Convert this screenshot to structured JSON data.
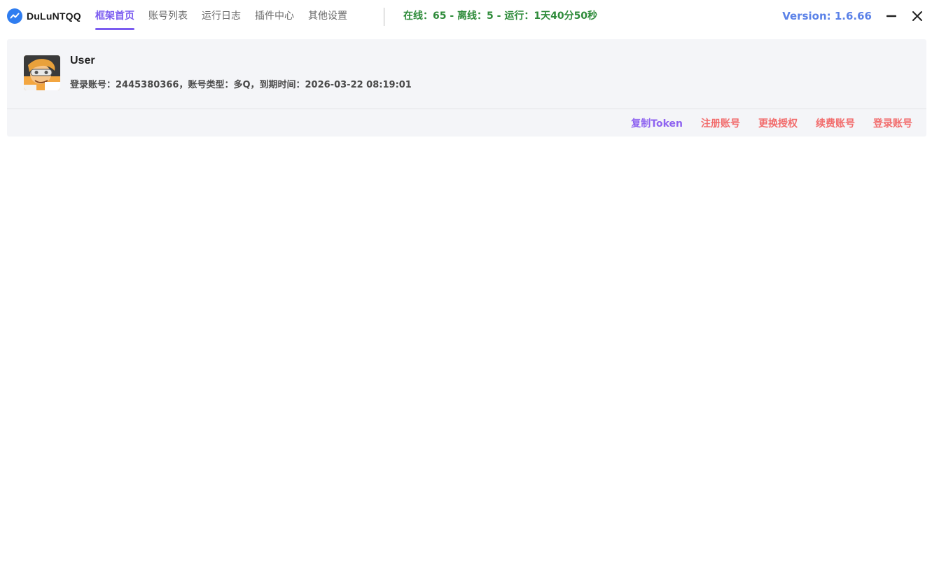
{
  "app": {
    "name": "DuLuNTQQ",
    "version": "Version: 1.6.66",
    "status": "在线：65 - 离线：5 - 运行：1天40分50秒"
  },
  "tabs": [
    {
      "label": "框架首页",
      "active": true
    },
    {
      "label": "账号列表",
      "active": false
    },
    {
      "label": "运行日志",
      "active": false
    },
    {
      "label": "插件中心",
      "active": false
    },
    {
      "label": "其他设置",
      "active": false
    }
  ],
  "user": {
    "name": "User",
    "info": "登录账号：2445380366，账号类型：多Q，到期时间：2026-03-22 08:19:01"
  },
  "actions": {
    "copy_token": "复制Token",
    "register": "注册账号",
    "change_auth": "更换授权",
    "renew": "续费账号",
    "login": "登录账号"
  },
  "colors": {
    "accent": "#7b5cf0",
    "status_green": "#2e8b3a",
    "version_blue": "#5b82e8",
    "danger_red": "#f26d6d"
  },
  "icons": {
    "logo": "app-logo-icon",
    "minimize": "minimize-icon",
    "close": "close-icon"
  }
}
